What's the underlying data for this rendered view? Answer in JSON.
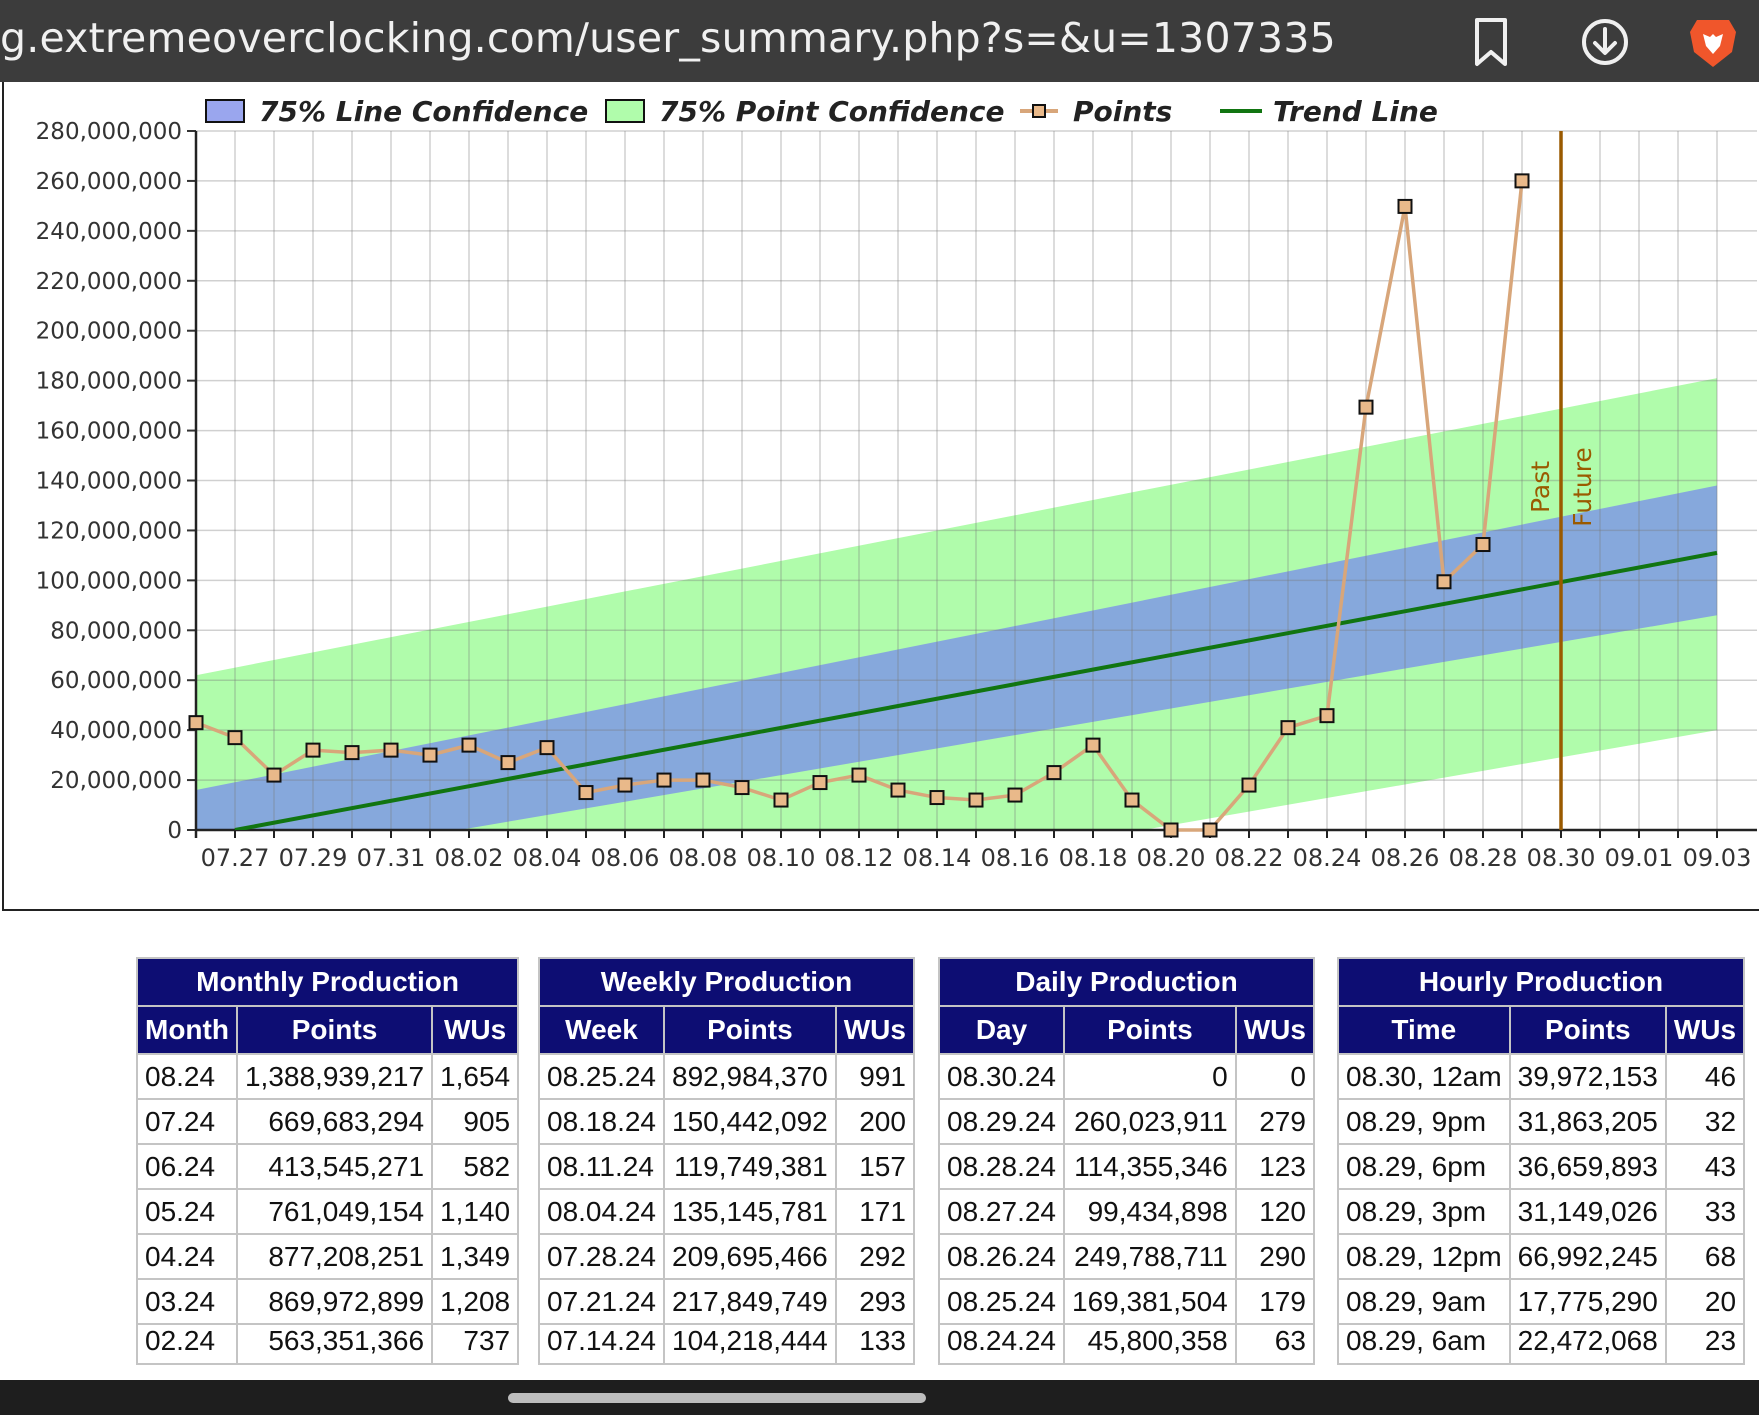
{
  "browser": {
    "url": "g.extremeoverclocking.com/user_summary.php?s=&u=1307335",
    "icons": [
      "bookmark-icon",
      "download-icon",
      "brave-lion-icon"
    ],
    "brand_color": "#f0562b"
  },
  "chart_data": {
    "type": "line",
    "legend": [
      {
        "label": "75% Line Confidence",
        "color": "#9aa6ee"
      },
      {
        "label": "75% Point Confidence",
        "color": "#b0fcab"
      },
      {
        "label": "Points",
        "color": "#d8a67a"
      },
      {
        "label": "Trend Line",
        "color": "#117511"
      }
    ],
    "legend_position": "top",
    "x_tick_labels": [
      "07.27",
      "07.29",
      "07.31",
      "08.02",
      "08.04",
      "08.06",
      "08.08",
      "08.10",
      "08.12",
      "08.14",
      "08.16",
      "08.18",
      "08.20",
      "08.22",
      "08.24",
      "08.26",
      "08.28",
      "08.30",
      "09.01",
      "09.03"
    ],
    "y_tick_labels": [
      "0",
      "20,000,000",
      "40,000,000",
      "60,000,000",
      "80,000,000",
      "100,000,000",
      "120,000,000",
      "140,000,000",
      "160,000,000",
      "180,000,000",
      "200,000,000",
      "220,000,000",
      "240,000,000",
      "260,000,000",
      "280,000,000"
    ],
    "ylim": [
      0,
      280000000
    ],
    "xlim": [
      "07.26",
      "09.03"
    ],
    "grid": true,
    "series": [
      {
        "name": "Points",
        "x": [
          "07.26",
          "07.27",
          "07.28",
          "07.29",
          "07.30",
          "07.31",
          "08.01",
          "08.02",
          "08.03",
          "08.04",
          "08.05",
          "08.06",
          "08.07",
          "08.08",
          "08.09",
          "08.10",
          "08.11",
          "08.12",
          "08.13",
          "08.14",
          "08.15",
          "08.16",
          "08.17",
          "08.18",
          "08.19",
          "08.20",
          "08.21",
          "08.22",
          "08.23",
          "08.24",
          "08.25",
          "08.26",
          "08.27",
          "08.28",
          "08.29"
        ],
        "values": [
          43000000,
          37000000,
          22000000,
          32000000,
          31000000,
          32000000,
          30000000,
          34000000,
          27000000,
          33000000,
          15000000,
          18000000,
          20000000,
          20000000,
          17000000,
          12000000,
          19000000,
          22000000,
          16000000,
          13000000,
          12000000,
          14000000,
          23000000,
          34000000,
          12000000,
          0,
          0,
          18000000,
          41000000,
          45800358,
          169381504,
          249788711,
          99434898,
          114355346,
          260023911
        ]
      }
    ],
    "trend_line": {
      "x": [
        "07.27",
        "09.03"
      ],
      "values": [
        0,
        111000000
      ]
    },
    "line_confidence_band": {
      "x": [
        "07.26",
        "09.03"
      ],
      "lower": [
        -18000000,
        86000000
      ],
      "upper": [
        16000000,
        138000000
      ]
    },
    "point_confidence_band": {
      "x": [
        "07.26",
        "09.03"
      ],
      "lower": [
        -66000000,
        40000000
      ],
      "upper": [
        62000000,
        181000000
      ]
    },
    "annotations": [
      {
        "at": "08.30",
        "label_before": "Past",
        "label_after": "Future",
        "color": "#9a5a00"
      }
    ]
  },
  "tables": [
    {
      "title": "Monthly Production",
      "headers": [
        "Month",
        "Points",
        "WUs"
      ],
      "rows": [
        [
          "08.24",
          "1,388,939,217",
          "1,654"
        ],
        [
          "07.24",
          "669,683,294",
          "905"
        ],
        [
          "06.24",
          "413,545,271",
          "582"
        ],
        [
          "05.24",
          "761,049,154",
          "1,140"
        ],
        [
          "04.24",
          "877,208,251",
          "1,349"
        ],
        [
          "03.24",
          "869,972,899",
          "1,208"
        ],
        [
          "02.24",
          "563,351,366",
          "737"
        ]
      ]
    },
    {
      "title": "Weekly Production",
      "headers": [
        "Week",
        "Points",
        "WUs"
      ],
      "rows": [
        [
          "08.25.24",
          "892,984,370",
          "991"
        ],
        [
          "08.18.24",
          "150,442,092",
          "200"
        ],
        [
          "08.11.24",
          "119,749,381",
          "157"
        ],
        [
          "08.04.24",
          "135,145,781",
          "171"
        ],
        [
          "07.28.24",
          "209,695,466",
          "292"
        ],
        [
          "07.21.24",
          "217,849,749",
          "293"
        ],
        [
          "07.14.24",
          "104,218,444",
          "133"
        ]
      ]
    },
    {
      "title": "Daily Production",
      "headers": [
        "Day",
        "Points",
        "WUs"
      ],
      "rows": [
        [
          "08.30.24",
          "0",
          "0"
        ],
        [
          "08.29.24",
          "260,023,911",
          "279"
        ],
        [
          "08.28.24",
          "114,355,346",
          "123"
        ],
        [
          "08.27.24",
          "99,434,898",
          "120"
        ],
        [
          "08.26.24",
          "249,788,711",
          "290"
        ],
        [
          "08.25.24",
          "169,381,504",
          "179"
        ],
        [
          "08.24.24",
          "45,800,358",
          "63"
        ]
      ]
    },
    {
      "title": "Hourly Production",
      "headers": [
        "Time",
        "Points",
        "WUs"
      ],
      "rows": [
        [
          "08.30, 12am",
          "39,972,153",
          "46"
        ],
        [
          "08.29, 9pm",
          "31,863,205",
          "32"
        ],
        [
          "08.29, 6pm",
          "36,659,893",
          "43"
        ],
        [
          "08.29, 3pm",
          "31,149,026",
          "33"
        ],
        [
          "08.29, 12pm",
          "66,992,245",
          "68"
        ],
        [
          "08.29, 9am",
          "17,775,290",
          "20"
        ],
        [
          "08.29, 6am",
          "22,472,068",
          "23"
        ]
      ]
    }
  ]
}
